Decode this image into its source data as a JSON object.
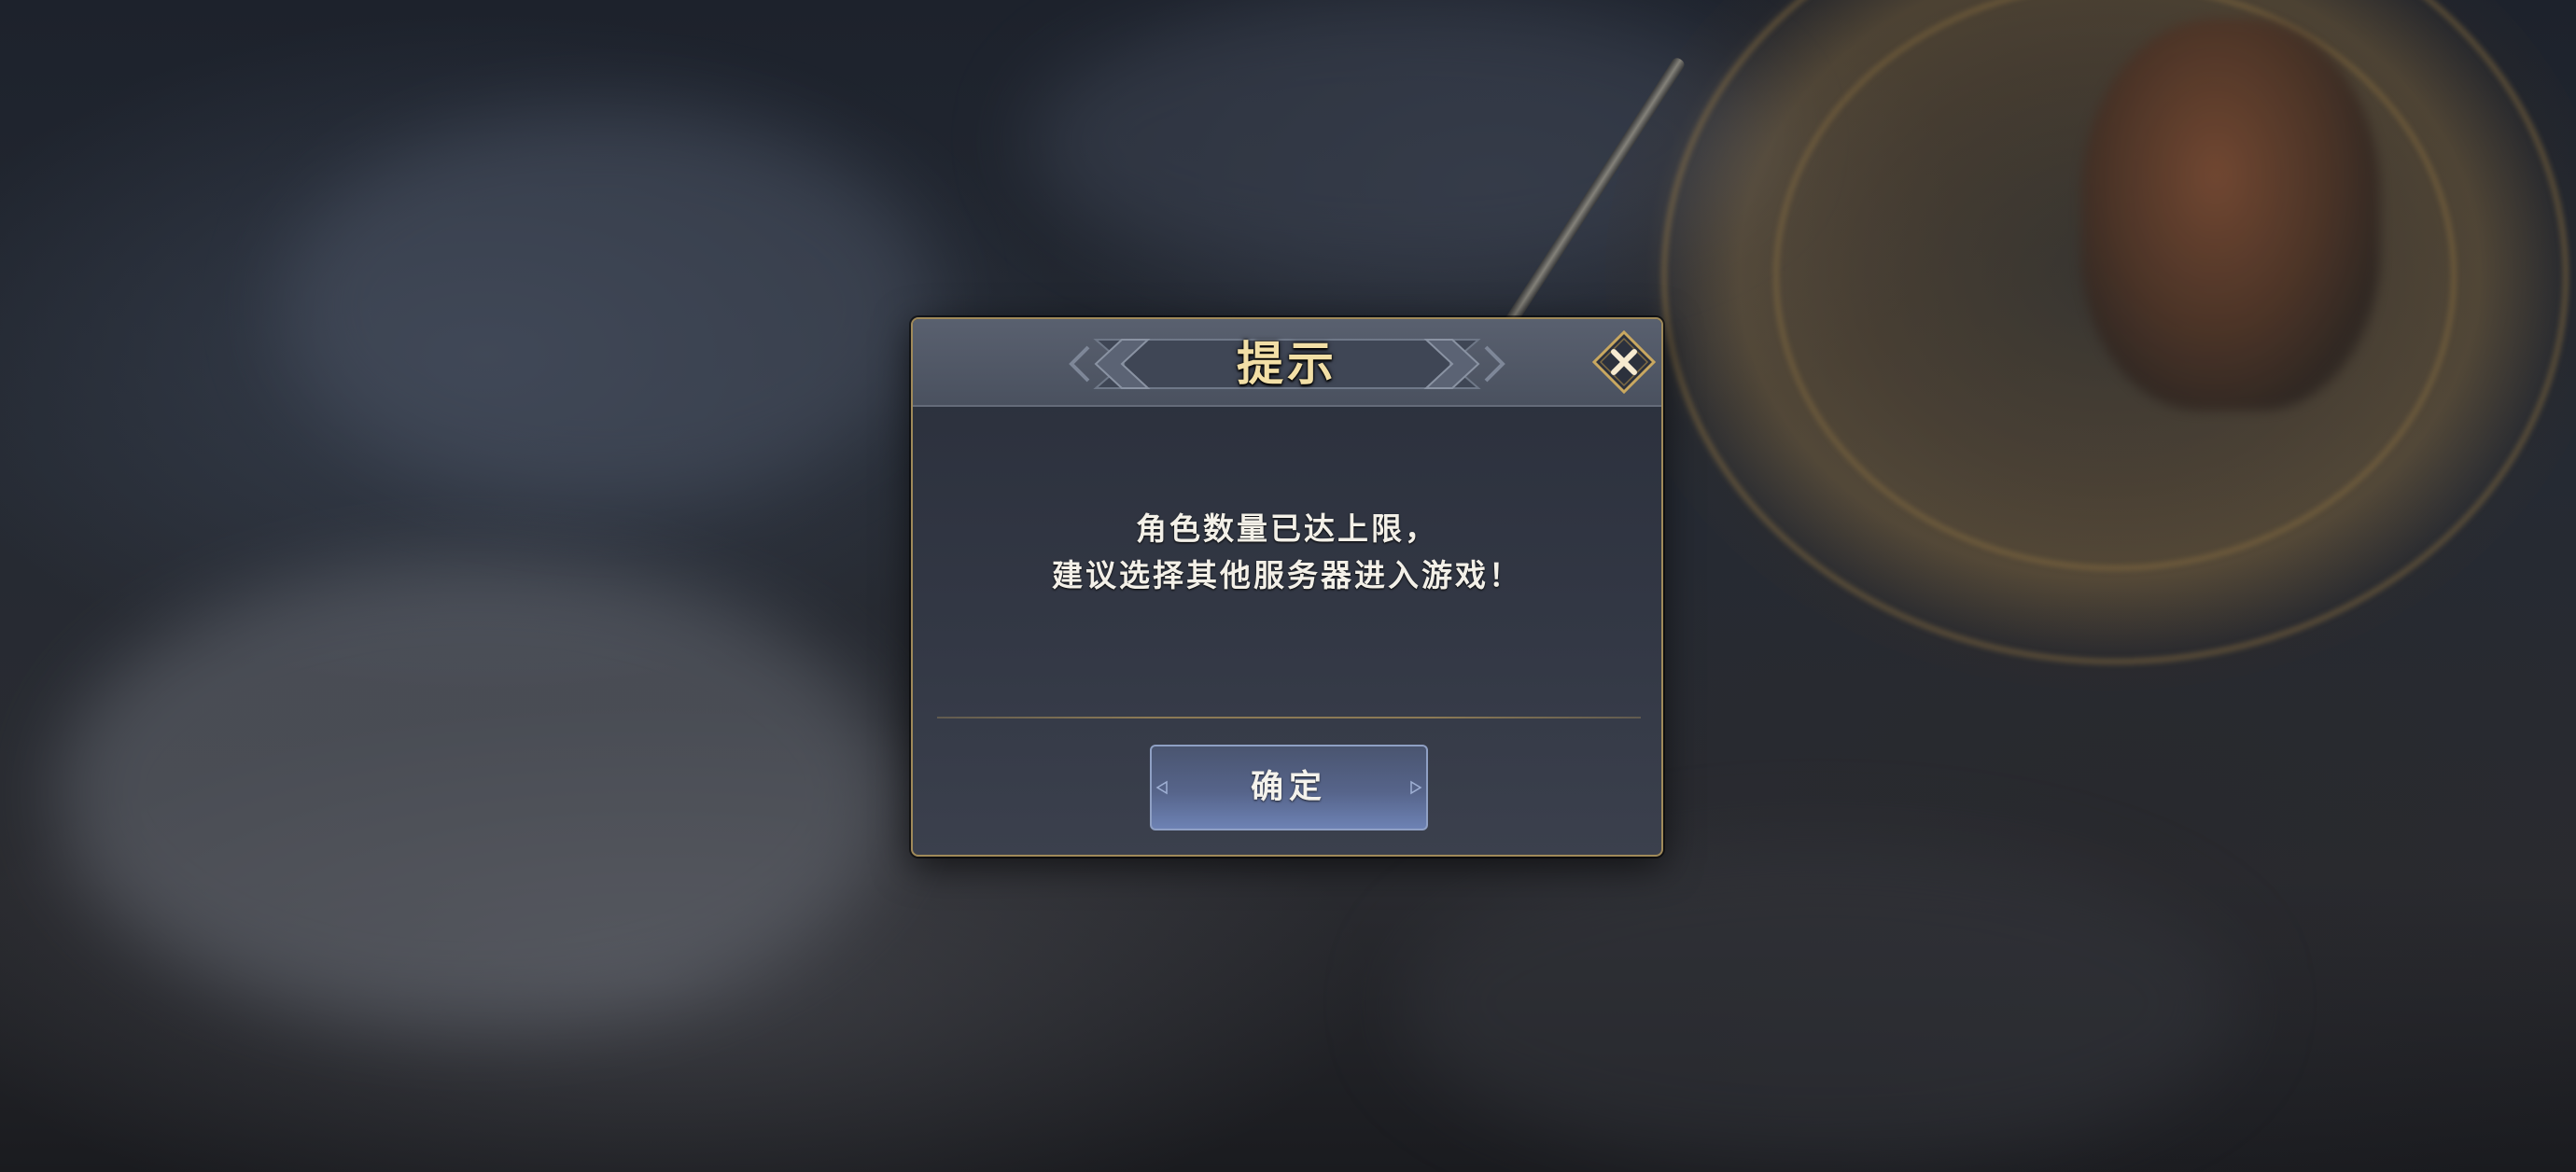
{
  "dialog": {
    "title": "提示",
    "message_lines": [
      "角色数量已达上限，",
      "建议选择其他服务器进入游戏！"
    ],
    "confirm_label": "确定",
    "close_icon": "close-x-icon"
  },
  "colors": {
    "title_gold": "#f2dfa6",
    "frame_gold": "#a08a5a",
    "button_blue": "#56648a",
    "panel": "#333845"
  }
}
